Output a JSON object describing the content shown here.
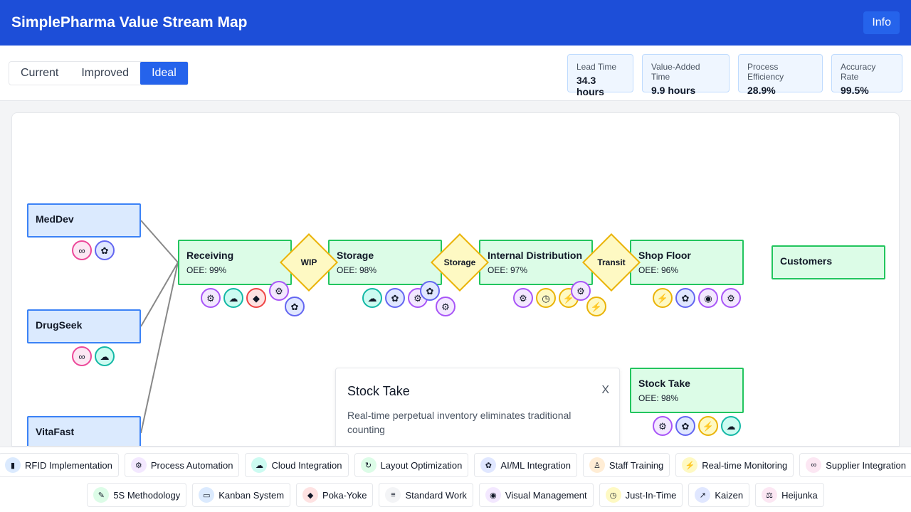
{
  "header": {
    "title": "SimplePharma Value Stream Map",
    "info_label": "Info"
  },
  "tabs": [
    {
      "label": "Current",
      "active": false
    },
    {
      "label": "Improved",
      "active": false
    },
    {
      "label": "Ideal",
      "active": true
    }
  ],
  "metrics": [
    {
      "label": "Lead Time",
      "value": "34.3 hours"
    },
    {
      "label": "Value-Added Time",
      "value": "9.9 hours"
    },
    {
      "label": "Process Efficiency",
      "value": "28.9%"
    },
    {
      "label": "Accuracy Rate",
      "value": "99.5%"
    }
  ],
  "suppliers": [
    {
      "name": "MedDev",
      "icons": [
        "link-icon",
        "brain-icon"
      ]
    },
    {
      "name": "DrugSeek",
      "icons": [
        "link-icon",
        "cloud-icon"
      ]
    },
    {
      "name": "VitaFast",
      "icons": []
    }
  ],
  "processes": [
    {
      "name": "Receiving",
      "oee": "OEE: 99%",
      "icons": [
        "robot-icon",
        "cloud-icon",
        "shield-icon",
        "robot-icon",
        "brain-icon"
      ]
    },
    {
      "name": "Storage",
      "oee": "OEE: 98%",
      "icons": [
        "cloud-icon",
        "brain-icon",
        "robot-icon",
        "brain-icon",
        "robot-icon"
      ]
    },
    {
      "name": "Internal Distribution",
      "oee": "OEE: 97%",
      "icons": [
        "robot-icon",
        "stopwatch-icon",
        "lightning-icon",
        "robot-icon",
        "lightning-icon"
      ]
    },
    {
      "name": "Shop Floor",
      "oee": "OEE: 96%",
      "icons": [
        "lightning-icon",
        "brain-icon",
        "eye-icon",
        "robot-icon"
      ]
    },
    {
      "name": "Stock Take",
      "oee": "OEE: 98%",
      "icons": [
        "robot-icon",
        "brain-icon",
        "lightning-icon",
        "cloud-icon"
      ]
    }
  ],
  "inventory": [
    {
      "label": "WIP"
    },
    {
      "label": "Storage"
    },
    {
      "label": "Transit"
    }
  ],
  "customer": {
    "name": "Customers"
  },
  "popup": {
    "title": "Stock Take",
    "close_label": "X",
    "body": "Real-time perpetual inventory eliminates traditional counting"
  },
  "legend_row1": [
    {
      "label": "RFID Implementation",
      "icon": "bar-chart-icon",
      "glyph": "▮",
      "color": "#dbeafe"
    },
    {
      "label": "Process Automation",
      "icon": "robot-icon",
      "glyph": "⚙",
      "color": "#f3e8ff"
    },
    {
      "label": "Cloud Integration",
      "icon": "cloud-icon",
      "glyph": "☁",
      "color": "#ccfbf1"
    },
    {
      "label": "Layout Optimization",
      "icon": "layout-icon",
      "glyph": "↻",
      "color": "#dcfce7"
    },
    {
      "label": "AI/ML Integration",
      "icon": "brain-icon",
      "glyph": "✿",
      "color": "#e0e7ff"
    },
    {
      "label": "Staff Training",
      "icon": "training-icon",
      "glyph": "♙",
      "color": "#ffedd5"
    },
    {
      "label": "Real-time Monitoring",
      "icon": "lightning-icon",
      "glyph": "⚡",
      "color": "#fef9c3"
    },
    {
      "label": "Supplier Integration",
      "icon": "link-icon",
      "glyph": "∞",
      "color": "#fce7f3"
    }
  ],
  "legend_row2": [
    {
      "label": "5S Methodology",
      "icon": "broom-icon",
      "glyph": "✎",
      "color": "#dcfce7"
    },
    {
      "label": "Kanban System",
      "icon": "card-icon",
      "glyph": "▭",
      "color": "#dbeafe"
    },
    {
      "label": "Poka-Yoke",
      "icon": "shield-icon",
      "glyph": "◆",
      "color": "#fee2e2"
    },
    {
      "label": "Standard Work",
      "icon": "document-icon",
      "glyph": "≡",
      "color": "#f3f4f6"
    },
    {
      "label": "Visual Management",
      "icon": "eye-icon",
      "glyph": "◉",
      "color": "#f3e8ff"
    },
    {
      "label": "Just-In-Time",
      "icon": "stopwatch-icon",
      "glyph": "◷",
      "color": "#fef9c3"
    },
    {
      "label": "Kaizen",
      "icon": "trend-icon",
      "glyph": "↗",
      "color": "#e0e7ff"
    },
    {
      "label": "Heijunka",
      "icon": "balance-icon",
      "glyph": "⚖",
      "color": "#fce7f3"
    }
  ]
}
